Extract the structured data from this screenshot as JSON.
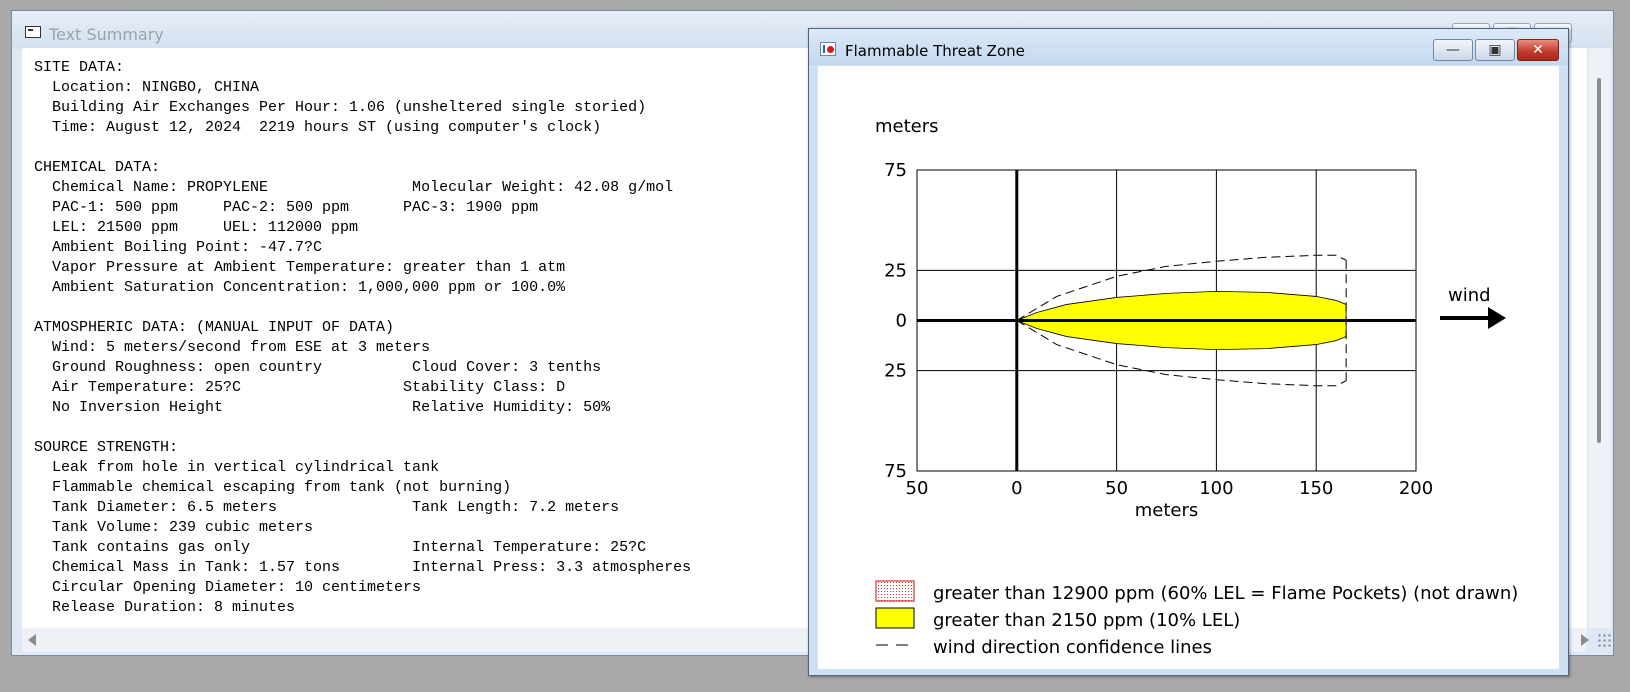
{
  "text_window": {
    "title": "Text Summary",
    "buttons": {
      "minimize": "—",
      "maximize": "□",
      "close": "✕"
    },
    "lines": [
      "SITE DATA:",
      "  Location: NINGBO, CHINA",
      "  Building Air Exchanges Per Hour: 1.06 (unsheltered single storied)",
      "  Time: August 12, 2024  2219 hours ST (using computer's clock)",
      "",
      "CHEMICAL DATA:",
      "  Chemical Name: PROPYLENE                Molecular Weight: 42.08 g/mol",
      "  PAC-1: 500 ppm     PAC-2: 500 ppm      PAC-3: 1900 ppm",
      "  LEL: 21500 ppm     UEL: 112000 ppm",
      "  Ambient Boiling Point: -47.7?C",
      "  Vapor Pressure at Ambient Temperature: greater than 1 atm",
      "  Ambient Saturation Concentration: 1,000,000 ppm or 100.0%",
      "",
      "ATMOSPHERIC DATA: (MANUAL INPUT OF DATA)",
      "  Wind: 5 meters/second from ESE at 3 meters",
      "  Ground Roughness: open country          Cloud Cover: 3 tenths",
      "  Air Temperature: 25?C                  Stability Class: D",
      "  No Inversion Height                     Relative Humidity: 50%",
      "",
      "SOURCE STRENGTH:",
      "  Leak from hole in vertical cylindrical tank",
      "  Flammable chemical escaping from tank (not burning)",
      "  Tank Diameter: 6.5 meters               Tank Length: 7.2 meters",
      "  Tank Volume: 239 cubic meters",
      "  Tank contains gas only                  Internal Temperature: 25?C",
      "  Chemical Mass in Tank: 1.57 tons        Internal Press: 3.3 atmospheres",
      "  Circular Opening Diameter: 10 centimeters",
      "  Release Duration: 8 minutes"
    ]
  },
  "threat_window": {
    "title": "Flammable Threat Zone",
    "buttons": {
      "minimize": "—",
      "maximize": "▣",
      "close": "✕"
    },
    "wind_label": "wind",
    "legend": [
      {
        "label": "greater than 12900 ppm (60% LEL = Flame Pockets) (not drawn)",
        "swatch": "red-dotted",
        "color": "#e03030"
      },
      {
        "label": "greater than 2150 ppm (10% LEL)",
        "swatch": "yellow-fill",
        "color": "#ffff00"
      },
      {
        "label": "wind direction confidence lines",
        "swatch": "dashed-line",
        "color": "#000000"
      }
    ]
  },
  "chart_data": {
    "type": "area",
    "ylabel": "meters",
    "xlabel": "meters",
    "x_ticks": [
      "50",
      "0",
      "50",
      "100",
      "150",
      "200"
    ],
    "x_tick_values": [
      -50,
      0,
      50,
      100,
      150,
      200
    ],
    "y_ticks": [
      "75",
      "25",
      "0",
      "25",
      "75"
    ],
    "y_tick_values": [
      75,
      25,
      0,
      -25,
      -75
    ],
    "xlim": [
      -50,
      200
    ],
    "ylim": [
      -75,
      75
    ],
    "grid": true,
    "series": [
      {
        "name": "greater than 2150 ppm (10% LEL)",
        "kind": "filled-zone",
        "color": "#ffff00",
        "x": [
          0,
          10,
          25,
          50,
          75,
          100,
          125,
          150,
          160,
          165
        ],
        "y_half_width": [
          0,
          4,
          8,
          11.5,
          13.5,
          14.5,
          14,
          12,
          10,
          8
        ]
      },
      {
        "name": "wind direction confidence lines",
        "kind": "dashed-envelope",
        "x": [
          0,
          20,
          50,
          75,
          100,
          125,
          150,
          160,
          165
        ],
        "y_half_width": [
          0,
          12,
          22,
          27,
          29.5,
          31.5,
          32.5,
          32.5,
          30
        ]
      }
    ]
  }
}
